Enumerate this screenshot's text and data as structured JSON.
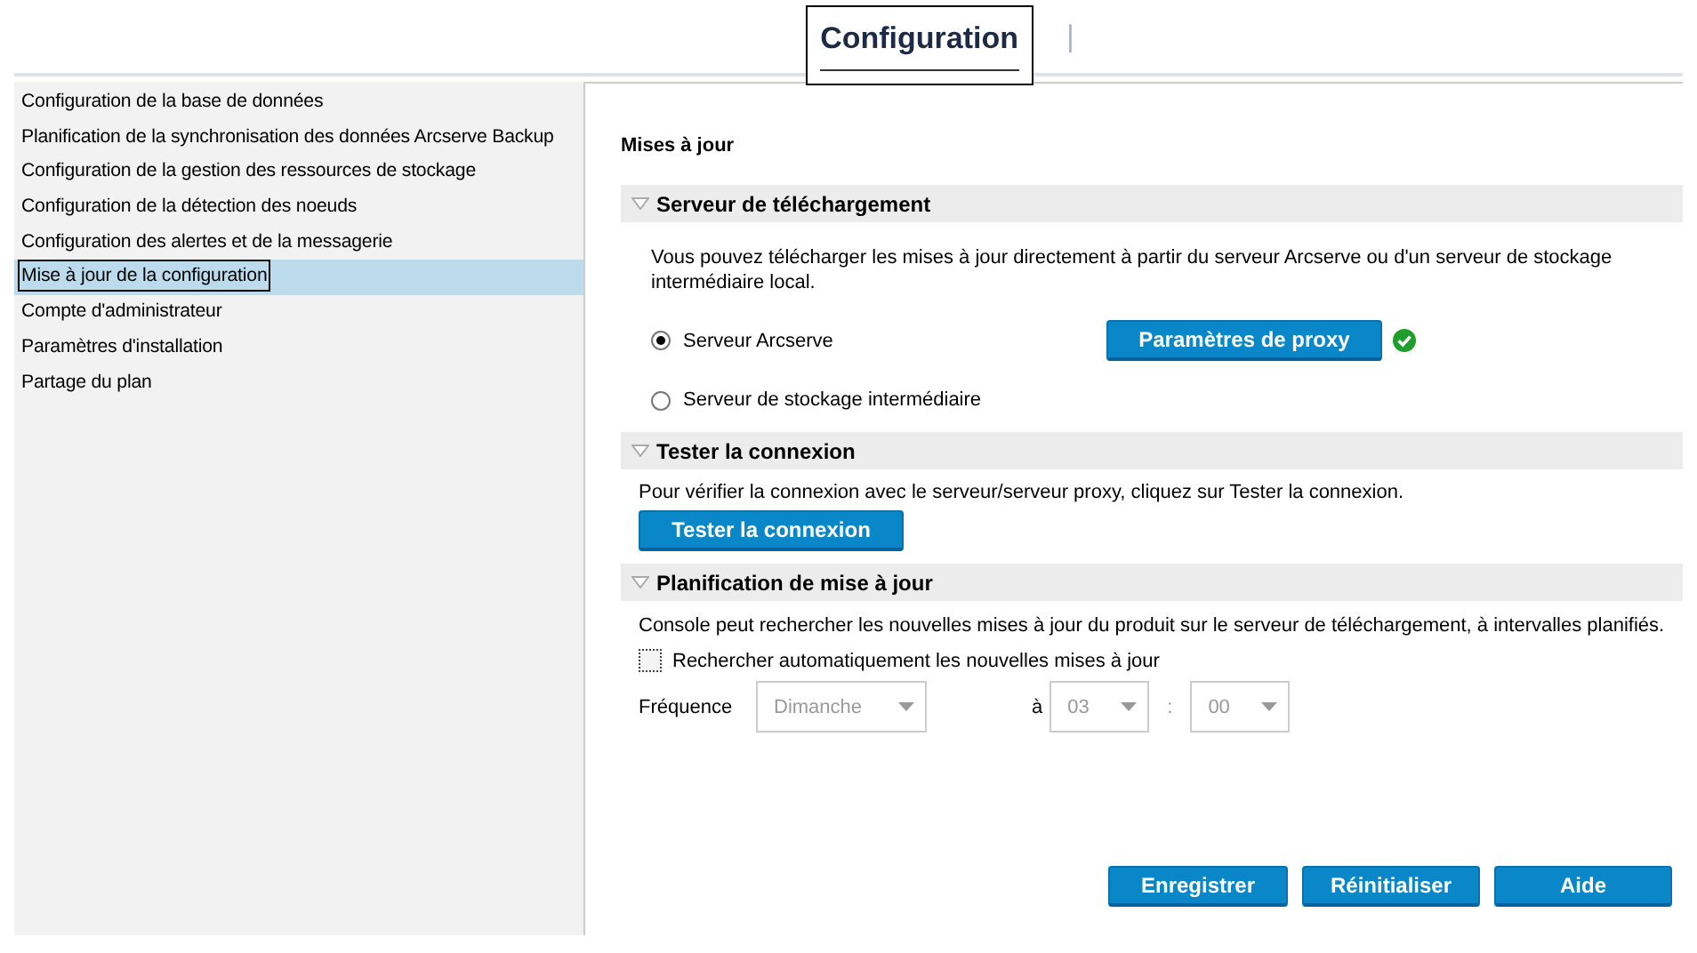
{
  "tabs": [
    {
      "label": "Configuration",
      "selected": true
    },
    {
      "label": "|",
      "selected": false
    }
  ],
  "sidebar": {
    "items": [
      {
        "label": "Configuration de la base de données",
        "selected": false
      },
      {
        "label": "Planification de la synchronisation des données Arcserve Backup",
        "selected": false
      },
      {
        "label": "Configuration de la gestion des ressources de stockage",
        "selected": false
      },
      {
        "label": "Configuration de la détection des noeuds",
        "selected": false
      },
      {
        "label": "Configuration des alertes et de la messagerie",
        "selected": false
      },
      {
        "label": "Mise à jour de la configuration",
        "selected": true
      },
      {
        "label": "Compte d'administrateur",
        "selected": false
      },
      {
        "label": "Paramètres d'installation",
        "selected": false
      },
      {
        "label": "Partage du plan",
        "selected": false
      }
    ]
  },
  "page_title": "Mises à jour",
  "download_server": {
    "title": "Serveur de téléchargement",
    "expanded": true,
    "description": "Vous pouvez télécharger les mises à jour directement à partir du serveur Arcserve ou d'un serveur de stockage intermédiaire local.",
    "options": [
      {
        "label": "Serveur Arcserve",
        "selected": true
      },
      {
        "label": "Serveur de stockage intermédiaire",
        "selected": false
      }
    ],
    "proxy_button": "Paramètres de proxy",
    "proxy_ok": true
  },
  "test_connection": {
    "title": "Tester la connexion",
    "expanded": true,
    "description": "Pour vérifier la connexion avec le serveur/serveur proxy, cliquez sur Tester la connexion.",
    "button": "Tester la connexion"
  },
  "schedule": {
    "title": "Planification de mise à jour",
    "expanded": true,
    "description": "Console peut rechercher les nouvelles mises à jour du produit sur le serveur de téléchargement, à intervalles planifiés.",
    "auto_check": {
      "label": "Rechercher automatiquement les nouvelles mises à jour",
      "checked": false
    },
    "frequency_label": "Fréquence",
    "frequency": {
      "value": "Dimanche",
      "disabled": true
    },
    "at_label": "à",
    "hour": {
      "value": "03",
      "disabled": true
    },
    "separator": ":",
    "minute": {
      "value": "00",
      "disabled": true
    }
  },
  "buttons": [
    "Enregistrer",
    "Réinitialiser",
    "Aide"
  ]
}
